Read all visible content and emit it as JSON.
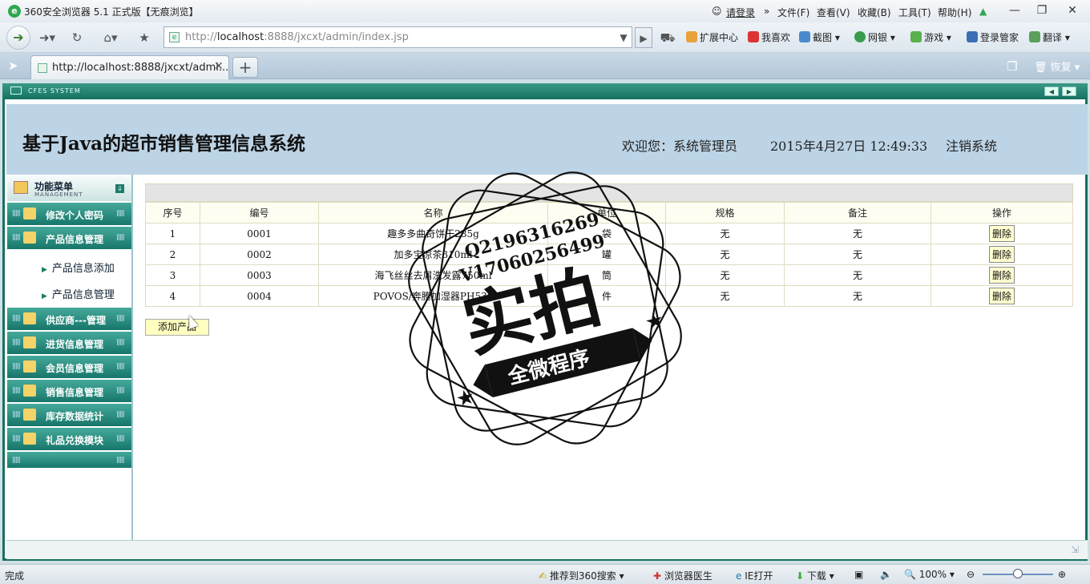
{
  "browser": {
    "title": "360安全浏览器 5.1 正式版【无痕浏览】",
    "login": "请登录",
    "menus": [
      "文件(F)",
      "查看(V)",
      "收藏(B)",
      "工具(T)",
      "帮助(H)"
    ],
    "address_prefix": "http://",
    "address_host": "localhost",
    "address_rest": ":8888/jxcxt/admin/index.jsp",
    "tools": [
      "扩展中心",
      "我喜欢",
      "截图",
      "网银",
      "游戏",
      "登录管家",
      "翻译"
    ],
    "tab_title": "http://localhost:8888/jxcxt/admi...",
    "restore": "恢复",
    "status_left": "完成",
    "status_items": [
      "推荐到360搜索",
      "浏览器医生",
      "IE打开",
      "下载"
    ],
    "zoom": "100%"
  },
  "app": {
    "system_label": "CFES SYSTEM",
    "title": "基于Java的超市销售管理信息系统",
    "welcome": "欢迎您：系统管理员",
    "datetime": "2015年4月27日  12:49:33",
    "logout": "注销系统",
    "menu_title": "功能菜单",
    "menu_sub": "MANAGEMENT",
    "menu_items": [
      {
        "label": "修改个人密码"
      },
      {
        "label": "产品信息管理"
      },
      {
        "label": "供应商---管理"
      },
      {
        "label": "进货信息管理"
      },
      {
        "label": "会员信息管理"
      },
      {
        "label": "销售信息管理"
      },
      {
        "label": "库存数据统计"
      },
      {
        "label": "礼品兑换模块"
      }
    ],
    "sub_items": [
      "产品信息添加",
      "产品信息管理"
    ],
    "table": {
      "headers": [
        "序号",
        "编号",
        "名称",
        "单位",
        "规格",
        "备注",
        "操作"
      ],
      "rows": [
        [
          "1",
          "0001",
          "趣多多曲奇饼干285g",
          "袋",
          "无",
          "无",
          "删除"
        ],
        [
          "2",
          "0002",
          "加多宝凉茶310ml",
          "罐",
          "无",
          "无",
          "删除"
        ],
        [
          "3",
          "0003",
          "海飞丝丝去屑洗发露750ml",
          "筒",
          "无",
          "无",
          "删除"
        ],
        [
          "4",
          "0004",
          "POVOS/奔腾加湿器PH530",
          "件",
          "无",
          "无",
          "删除"
        ]
      ]
    },
    "add_button": "添加产品"
  },
  "watermark": {
    "line1": "Q2196316269",
    "line2": "V17060256499",
    "big": "实拍",
    "banner": "全微程序"
  },
  "colors": {
    "accent": "#1a7060",
    "menu_green": "#16766a",
    "header_blue": "#bcd4e6"
  }
}
